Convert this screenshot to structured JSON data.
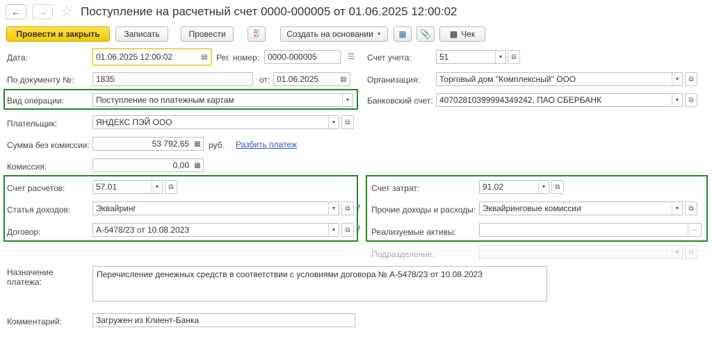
{
  "window": {
    "title": "Поступление на расчетный счет 0000-000005 от 01.06.2025 12:00:02"
  },
  "toolbar": {
    "post_close": "Провести и закрыть",
    "save": "Записать",
    "post": "Провести",
    "create_based": "Создать на основании",
    "receipt": "Чек",
    "dt_kt": "Дт Кт"
  },
  "fields": {
    "date_label": "Дата:",
    "date_value": "01.06.2025 12:00:02",
    "reg_label": "Рег. номер:",
    "reg_value": "0000-000005",
    "account_label": "Счет учета:",
    "account_value": "51",
    "doc_no_label": "По документу №:",
    "doc_no_value": "1835",
    "from_label": "от:",
    "from_value": "01.06.2025",
    "org_label": "Организация:",
    "org_value": "Торговый дом \"Комплексный\" ООО",
    "op_label": "Вид операции:",
    "op_value": "Поступление по платежным картам",
    "bank_label": "Банковский счет:",
    "bank_value": "40702810399994349242, ПАО СБЕРБАНК",
    "payer_label": "Плательщик:",
    "payer_value": "ЯНДЕКС ПЭЙ ООО",
    "sum_label": "Сумма без комиссии:",
    "sum_value": "53 792,65",
    "currency": "руб.",
    "split_link": "Разбить платеж",
    "commission_label": "Комиссия:",
    "commission_value": "0,00",
    "settle_label": "Счет расчетов:",
    "settle_value": "57.01",
    "income_label": "Статья доходов:",
    "income_value": "Эквайринг",
    "contract_label": "Договор:",
    "contract_value": "А-5478/23 от 10.08.2023",
    "cost_label": "Счет затрат:",
    "cost_value": "91.02",
    "other_label": "Прочие доходы и расходы:",
    "other_value": "Эквайринговые комиссии",
    "assets_label": "Реализуемые активы:",
    "assets_value": "",
    "dept_label": "Подразделение:",
    "dept_value": "",
    "purpose_label_1": "Назначение",
    "purpose_label_2": "платежа:",
    "purpose_value": "Перечисление денежных средств в соответствии с условиями договора № А-5478/23 от 10.08.2023",
    "comment_label": "Комментарий:",
    "comment_value": "Загружен из Клиент-Банка"
  },
  "help_mark": "?",
  "ellipsis": "..."
}
